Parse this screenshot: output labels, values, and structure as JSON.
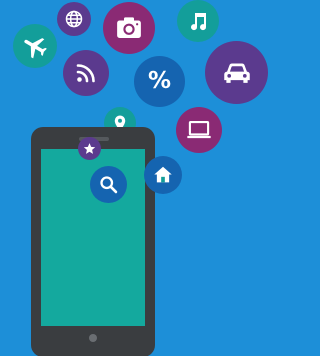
{
  "scene": {
    "background": "#1d8fd8",
    "phone": {
      "body_color": "#3a3d40",
      "screen_color": "#14a99e"
    },
    "icons": [
      {
        "name": "airplane-icon",
        "color": "#139e9a"
      },
      {
        "name": "globe-icon",
        "color": "#5b3a8e"
      },
      {
        "name": "camera-icon",
        "color": "#8a2a74"
      },
      {
        "name": "music-note-icon",
        "color": "#139e9a"
      },
      {
        "name": "wifi-signal-icon",
        "color": "#5b3a8e"
      },
      {
        "name": "percent-icon",
        "color": "#1564b0"
      },
      {
        "name": "car-icon",
        "color": "#5b3a8e"
      },
      {
        "name": "map-pin-icon",
        "color": "#139e9a"
      },
      {
        "name": "laptop-icon",
        "color": "#8a2a74"
      },
      {
        "name": "star-icon",
        "color": "#5b3a8e"
      },
      {
        "name": "home-icon",
        "color": "#1564b0"
      },
      {
        "name": "search-icon",
        "color": "#1564b0"
      }
    ],
    "percent_symbol": "%"
  }
}
